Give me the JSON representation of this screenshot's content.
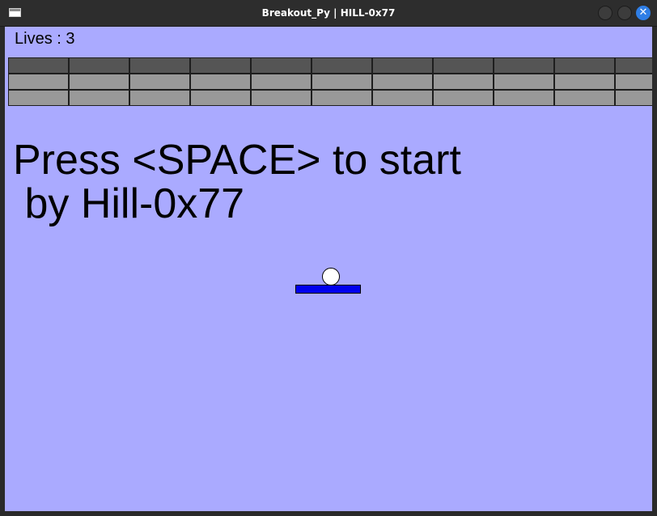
{
  "window": {
    "title": "Breakout_Py | HILL-0x77",
    "buttons": {
      "minimize": "",
      "maximize": "",
      "close": "✕"
    }
  },
  "game": {
    "background_color": "#aaaaff",
    "lives_label": "Lives : 3",
    "start_message_line1": "Press <SPACE> to start",
    "start_message_line2": " by Hill-0x77",
    "ball_color": "#ffffff",
    "paddle_color": "#0000ee",
    "bricks": {
      "columns": 11,
      "rows": [
        {
          "color": "#555555"
        },
        {
          "color": "#999999"
        },
        {
          "color": "#999999"
        }
      ]
    }
  }
}
